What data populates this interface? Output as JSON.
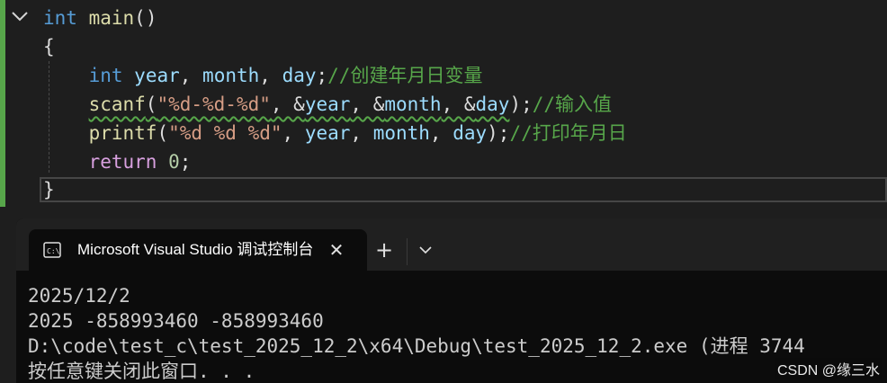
{
  "editor": {
    "lines": [
      [
        {
          "c": "kw",
          "t": "int"
        },
        {
          "c": "pl",
          "t": " "
        },
        {
          "c": "fn",
          "t": "main"
        },
        {
          "c": "pl",
          "t": "()"
        }
      ],
      [
        {
          "c": "pl",
          "t": "{"
        }
      ],
      [
        {
          "c": "pl",
          "t": "    "
        },
        {
          "c": "kw",
          "t": "int"
        },
        {
          "c": "pl",
          "t": " "
        },
        {
          "c": "id",
          "t": "year"
        },
        {
          "c": "pl",
          "t": ", "
        },
        {
          "c": "id",
          "t": "month"
        },
        {
          "c": "pl",
          "t": ", "
        },
        {
          "c": "id",
          "t": "day"
        },
        {
          "c": "pl",
          "t": ";"
        },
        {
          "c": "cm",
          "t": "//创建年月日变量"
        }
      ],
      [
        {
          "c": "pl",
          "t": "    "
        },
        {
          "c": "fn squig",
          "t": "scanf"
        },
        {
          "c": "pl squig",
          "t": "("
        },
        {
          "c": "str squig",
          "t": "\"%d-%d-%d\""
        },
        {
          "c": "pl squig",
          "t": ", &"
        },
        {
          "c": "id squig",
          "t": "year"
        },
        {
          "c": "pl squig",
          "t": ", &"
        },
        {
          "c": "id squig",
          "t": "month"
        },
        {
          "c": "pl squig",
          "t": ", &"
        },
        {
          "c": "id squig",
          "t": "day"
        },
        {
          "c": "pl",
          "t": ");"
        },
        {
          "c": "cm",
          "t": "//输入值"
        }
      ],
      [
        {
          "c": "pl",
          "t": "    "
        },
        {
          "c": "fn",
          "t": "printf"
        },
        {
          "c": "pl",
          "t": "("
        },
        {
          "c": "str",
          "t": "\"%d %d %d\""
        },
        {
          "c": "pl",
          "t": ", "
        },
        {
          "c": "id",
          "t": "year"
        },
        {
          "c": "pl",
          "t": ", "
        },
        {
          "c": "id",
          "t": "month"
        },
        {
          "c": "pl",
          "t": ", "
        },
        {
          "c": "id",
          "t": "day"
        },
        {
          "c": "pl",
          "t": ");"
        },
        {
          "c": "cm",
          "t": "//打印年月日"
        }
      ],
      [
        {
          "c": "pl",
          "t": "    "
        },
        {
          "c": "ctl",
          "t": "return"
        },
        {
          "c": "pl",
          "t": " "
        },
        {
          "c": "num",
          "t": "0"
        },
        {
          "c": "pl",
          "t": ";"
        }
      ],
      [
        {
          "c": "pl",
          "t": "}"
        }
      ]
    ]
  },
  "terminal": {
    "tab_title": "Microsoft Visual Studio 调试控制台",
    "close_glyph": "✕",
    "new_tab_glyph": "+",
    "output": [
      "2025/12/2",
      "2025 -858993460 -858993460",
      "D:\\code\\test_c\\test_2025_12_2\\x64\\Debug\\test_2025_12_2.exe (进程 3744",
      "按任意键关闭此窗口. . ."
    ]
  },
  "watermark": "CSDN @缘三水",
  "colors": {
    "editor_bg": "#1e1e1e",
    "terminal_bg": "#0c0c0c",
    "keyword": "#569cd6",
    "function": "#dcdcaa",
    "identifier": "#9cdcfe",
    "string": "#d69d85",
    "comment": "#57a64a",
    "control": "#d8a0df",
    "number": "#b5cea8"
  }
}
